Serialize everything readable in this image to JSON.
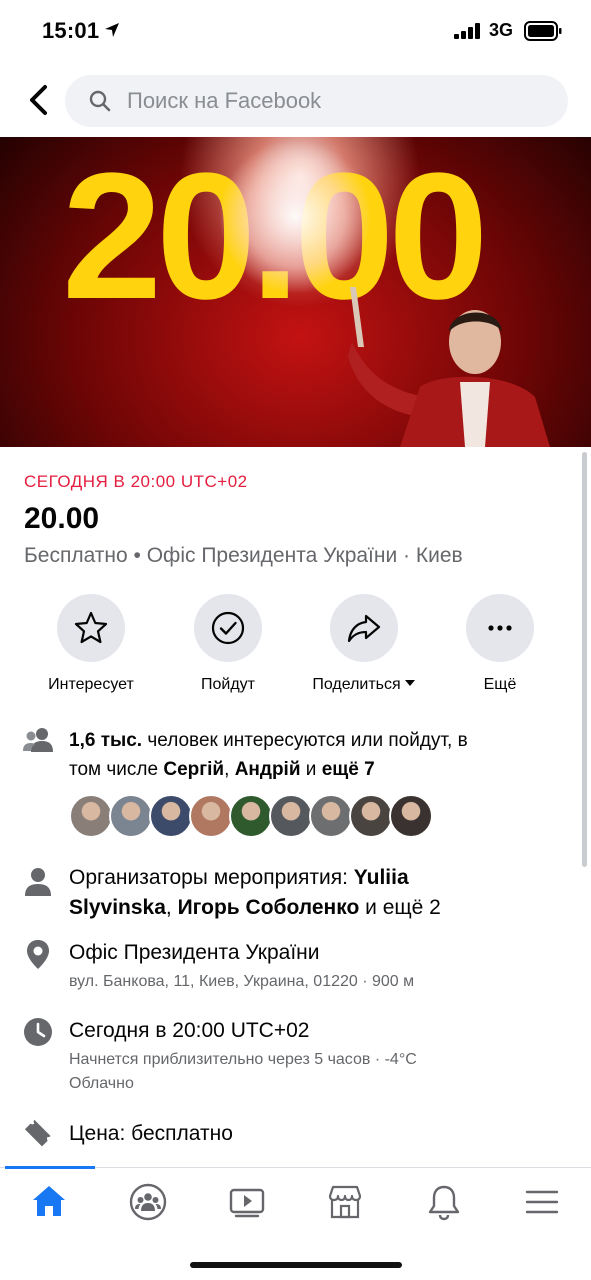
{
  "status": {
    "time": "15:01",
    "network": "3G"
  },
  "search": {
    "placeholder": "Поиск на Facebook"
  },
  "cover": {
    "text": "20.00"
  },
  "event": {
    "date_line": "СЕГОДНЯ В 20:00 UTC+02",
    "title": "20.00",
    "subtitle": "Бесплатно • Офіс Президента України · Киев"
  },
  "actions": [
    {
      "label": "Интересует",
      "icon": "star-icon"
    },
    {
      "label": "Пойдут",
      "icon": "check-circle-icon"
    },
    {
      "label": "Поделиться",
      "icon": "share-icon"
    },
    {
      "label": "Ещё",
      "icon": "more-icon"
    }
  ],
  "attendees": {
    "count": "1,6 тыс.",
    "text1": " человек интересуются или пойдут, в",
    "text2": "том числе ",
    "name1": "Сергій",
    "sep": ", ",
    "name2": "Андрій",
    "and": " и ",
    "more": "ещё 7",
    "avatar_colors": [
      "#8a7f78",
      "#7b8491",
      "#3d4b6b",
      "#b07860",
      "#2f5a2e",
      "#55585c",
      "#6d6e70",
      "#4a4440",
      "#3a3230"
    ]
  },
  "organizers": {
    "prefix": "Организаторы мероприятия: ",
    "name1a": "Yuliia",
    "name1b": "Slyvinska",
    "sep": ", ",
    "name2": "Игорь Соболенко",
    "suffix": " и ещё 2"
  },
  "location": {
    "name": "Офіс Президента України",
    "address": "вул. Банкова, 11, Киев, Украина, 01220 · 900 м"
  },
  "time_info": {
    "main": "Сегодня в 20:00 UTC+02",
    "detail1": "Начнется приблизительно через 5 часов · -4°C",
    "detail2": "Облачно"
  },
  "price": {
    "text": "Цена: бесплатно"
  },
  "nav": {
    "tabs": [
      "home-icon",
      "groups-icon",
      "watch-icon",
      "marketplace-icon",
      "notifications-icon",
      "menu-icon"
    ]
  },
  "colors": {
    "accent": "#1877f2",
    "date_red": "#e41e3f",
    "cover_yellow": "#ffd30d"
  }
}
